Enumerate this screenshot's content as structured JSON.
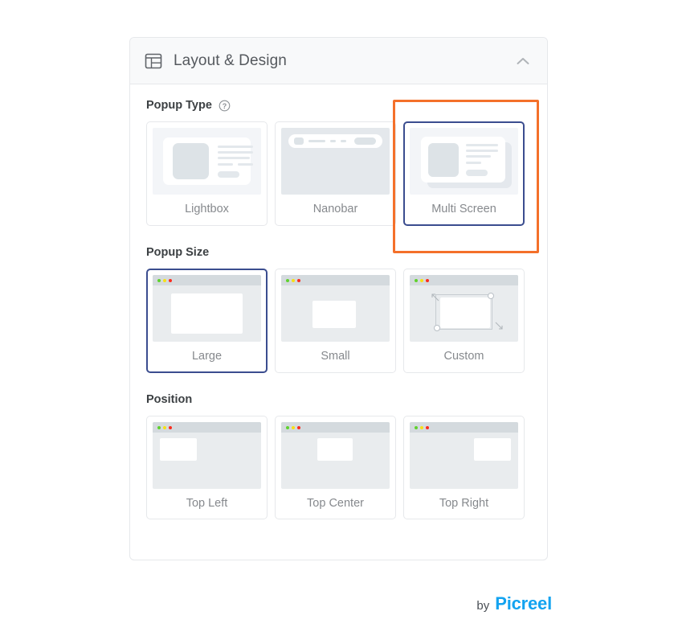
{
  "panel": {
    "header": {
      "title": "Layout & Design",
      "icon": "layout-icon",
      "collapse_icon": "chevron-up-icon"
    }
  },
  "sections": {
    "popup_type": {
      "title": "Popup Type",
      "help_icon": "question-mark-circle-icon",
      "options": [
        {
          "label": "Lightbox",
          "selected": false
        },
        {
          "label": "Nanobar",
          "selected": false
        },
        {
          "label": "Multi Screen",
          "selected": true
        }
      ]
    },
    "popup_size": {
      "title": "Popup Size",
      "options": [
        {
          "label": "Large",
          "selected": true
        },
        {
          "label": "Small",
          "selected": false
        },
        {
          "label": "Custom",
          "selected": false
        }
      ]
    },
    "position": {
      "title": "Position",
      "options": [
        {
          "label": "Top Left",
          "selected": false
        },
        {
          "label": "Top Center",
          "selected": false
        },
        {
          "label": "Top Right",
          "selected": false
        }
      ]
    }
  },
  "highlight": {
    "target": "Multi Screen",
    "color": "#f4702a"
  },
  "footer": {
    "by_label": "by",
    "brand": "Picreel",
    "brand_color": "#13a3f0"
  },
  "colors": {
    "selected_border": "#3b4d8f",
    "panel_border": "#e6e8eb",
    "header_bg": "#f8f9fa",
    "label_text": "#86898d"
  }
}
